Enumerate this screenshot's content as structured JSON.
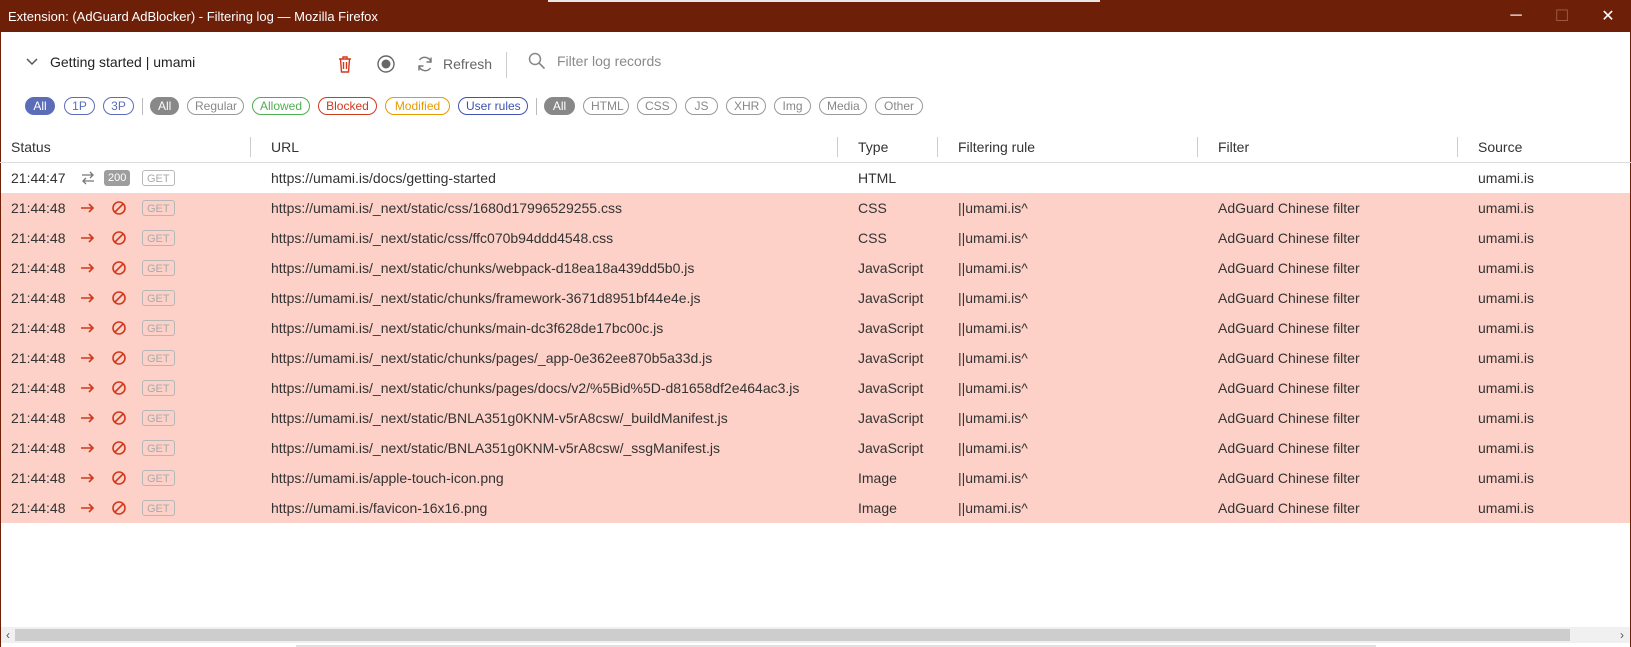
{
  "window": {
    "title": "Extension: (AdGuard AdBlocker) - Filtering log — Mozilla Firefox",
    "minimize_glyph": "─",
    "maximize_glyph": "☐",
    "close_glyph": "✕"
  },
  "toolbar": {
    "tab_select": "Getting started | umami",
    "refresh_label": "Refresh",
    "search_placeholder": "Filter log records"
  },
  "filters": {
    "party": [
      {
        "label": "All",
        "active": true
      },
      {
        "label": "1P",
        "active": false
      },
      {
        "label": "3P",
        "active": false
      }
    ],
    "events": [
      {
        "label": "All",
        "active": true,
        "color": "#888888"
      },
      {
        "label": "Regular",
        "active": false,
        "color": "#888888"
      },
      {
        "label": "Allowed",
        "active": false,
        "color": "#4caf50"
      },
      {
        "label": "Blocked",
        "active": false,
        "color": "#d0391c"
      },
      {
        "label": "Modified",
        "active": false,
        "color": "#e69a00"
      },
      {
        "label": "User rules",
        "active": false,
        "color": "#3f51b5"
      }
    ],
    "types": [
      {
        "label": "All",
        "active": true
      },
      {
        "label": "HTML",
        "active": false
      },
      {
        "label": "CSS",
        "active": false
      },
      {
        "label": "JS",
        "active": false
      },
      {
        "label": "XHR",
        "active": false
      },
      {
        "label": "Img",
        "active": false
      },
      {
        "label": "Media",
        "active": false
      },
      {
        "label": "Other",
        "active": false
      }
    ]
  },
  "columns": [
    "Status",
    "URL",
    "Type",
    "Filtering rule",
    "Filter",
    "Source"
  ],
  "rows": [
    {
      "time": "21:44:47",
      "blocked": false,
      "code": "200",
      "method": "GET",
      "url": "https://umami.is/docs/getting-started",
      "type": "HTML",
      "rule": "",
      "filter": "",
      "source": "umami.is"
    },
    {
      "time": "21:44:48",
      "blocked": true,
      "code": "",
      "method": "GET",
      "url": "https://umami.is/_next/static/css/1680d17996529255.css",
      "type": "CSS",
      "rule": "||umami.is^",
      "filter": "AdGuard Chinese filter",
      "source": "umami.is"
    },
    {
      "time": "21:44:48",
      "blocked": true,
      "code": "",
      "method": "GET",
      "url": "https://umami.is/_next/static/css/ffc070b94ddd4548.css",
      "type": "CSS",
      "rule": "||umami.is^",
      "filter": "AdGuard Chinese filter",
      "source": "umami.is"
    },
    {
      "time": "21:44:48",
      "blocked": true,
      "code": "",
      "method": "GET",
      "url": "https://umami.is/_next/static/chunks/webpack-d18ea18a439dd5b0.js",
      "type": "JavaScript",
      "rule": "||umami.is^",
      "filter": "AdGuard Chinese filter",
      "source": "umami.is"
    },
    {
      "time": "21:44:48",
      "blocked": true,
      "code": "",
      "method": "GET",
      "url": "https://umami.is/_next/static/chunks/framework-3671d8951bf44e4e.js",
      "type": "JavaScript",
      "rule": "||umami.is^",
      "filter": "AdGuard Chinese filter",
      "source": "umami.is"
    },
    {
      "time": "21:44:48",
      "blocked": true,
      "code": "",
      "method": "GET",
      "url": "https://umami.is/_next/static/chunks/main-dc3f628de17bc00c.js",
      "type": "JavaScript",
      "rule": "||umami.is^",
      "filter": "AdGuard Chinese filter",
      "source": "umami.is"
    },
    {
      "time": "21:44:48",
      "blocked": true,
      "code": "",
      "method": "GET",
      "url": "https://umami.is/_next/static/chunks/pages/_app-0e362ee870b5a33d.js",
      "type": "JavaScript",
      "rule": "||umami.is^",
      "filter": "AdGuard Chinese filter",
      "source": "umami.is"
    },
    {
      "time": "21:44:48",
      "blocked": true,
      "code": "",
      "method": "GET",
      "url": "https://umami.is/_next/static/chunks/pages/docs/v2/%5Bid%5D-d81658df2e464ac3.js",
      "type": "JavaScript",
      "rule": "||umami.is^",
      "filter": "AdGuard Chinese filter",
      "source": "umami.is"
    },
    {
      "time": "21:44:48",
      "blocked": true,
      "code": "",
      "method": "GET",
      "url": "https://umami.is/_next/static/BNLA351g0KNM-v5rA8csw/_buildManifest.js",
      "type": "JavaScript",
      "rule": "||umami.is^",
      "filter": "AdGuard Chinese filter",
      "source": "umami.is"
    },
    {
      "time": "21:44:48",
      "blocked": true,
      "code": "",
      "method": "GET",
      "url": "https://umami.is/_next/static/BNLA351g0KNM-v5rA8csw/_ssgManifest.js",
      "type": "JavaScript",
      "rule": "||umami.is^",
      "filter": "AdGuard Chinese filter",
      "source": "umami.is"
    },
    {
      "time": "21:44:48",
      "blocked": true,
      "code": "",
      "method": "GET",
      "url": "https://umami.is/apple-touch-icon.png",
      "type": "Image",
      "rule": "||umami.is^",
      "filter": "AdGuard Chinese filter",
      "source": "umami.is"
    },
    {
      "time": "21:44:48",
      "blocked": true,
      "code": "",
      "method": "GET",
      "url": "https://umami.is/favicon-16x16.png",
      "type": "Image",
      "rule": "||umami.is^",
      "filter": "AdGuard Chinese filter",
      "source": "umami.is"
    }
  ],
  "icons": {
    "allowed_row": "transfer-icon",
    "blocked_row": "arrow-right-icon",
    "blocked_mark": "blocked-icon"
  },
  "colors": {
    "titlebar": "#6e1f08",
    "blocked_row": "#fdd1c7",
    "accent_blue": "#3f51b5",
    "blocked_red": "#d0391c"
  },
  "scrollbar": {
    "left_arrow": "‹",
    "right_arrow": "›"
  }
}
